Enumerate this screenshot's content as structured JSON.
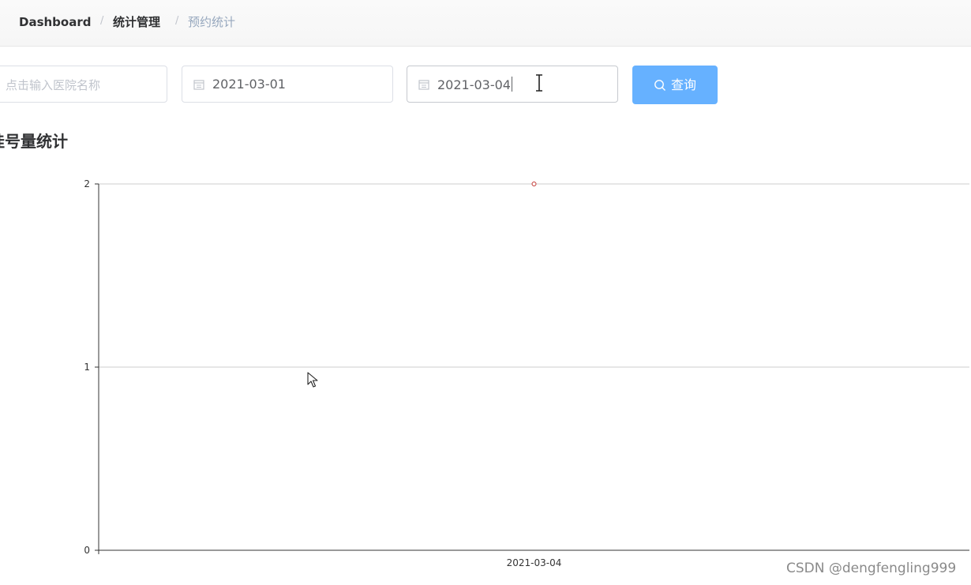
{
  "breadcrumb": {
    "items": [
      "Dashboard",
      "统计管理",
      "预约统计"
    ],
    "separator": "/"
  },
  "filters": {
    "hospital": {
      "value": "",
      "placeholder": "点击输入医院名称"
    },
    "start_date": {
      "value": "2021-03-01",
      "icon": "calendar-icon"
    },
    "end_date": {
      "value": "2021-03-04",
      "icon": "calendar-icon"
    },
    "query_button": {
      "label": "查询",
      "icon": "search-icon",
      "color": "#66b1ff"
    }
  },
  "section": {
    "title": "挂号量统计"
  },
  "chart_data": {
    "type": "line",
    "title": "挂号量统计",
    "x": [
      "2021-03-04"
    ],
    "series": [
      {
        "values": [
          2
        ],
        "color": "#c23531"
      }
    ],
    "ylim": [
      0,
      2
    ],
    "yticks": [
      0,
      1,
      2
    ],
    "grid": true,
    "xlabel": "",
    "ylabel": ""
  },
  "watermark": "CSDN @dengfengling999"
}
